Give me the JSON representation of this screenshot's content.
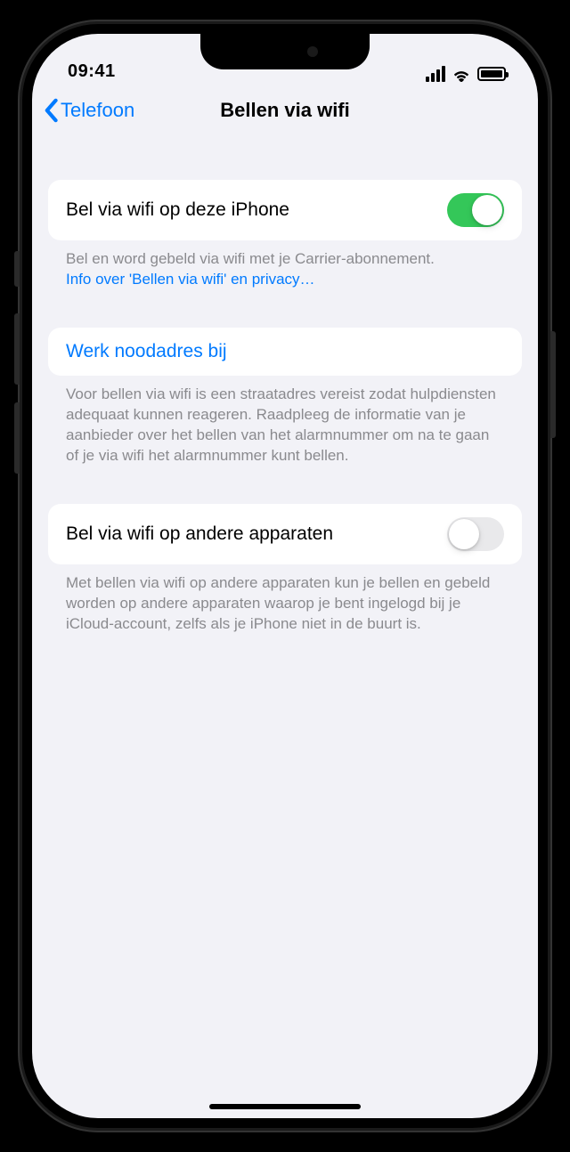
{
  "status": {
    "time": "09:41"
  },
  "nav": {
    "back_label": "Telefoon",
    "title": "Bellen via wifi"
  },
  "sections": {
    "wifi_this_iphone": {
      "label": "Bel via wifi op deze iPhone",
      "toggle_on": true,
      "footer_text": "Bel en word gebeld via wifi met je Carrier-abonnement.",
      "footer_link": "Info over 'Bellen via wifi' en privacy…"
    },
    "emergency": {
      "label": "Werk noodadres bij",
      "footer_text": "Voor bellen via wifi is een straatadres vereist zodat hulpdiensten adequaat kunnen reageren. Raadpleeg de informatie van je aanbieder over het bellen van het alarmnummer om na te gaan of je via wifi het alarmnummer kunt bellen."
    },
    "other_devices": {
      "label": "Bel via wifi op andere apparaten",
      "toggle_on": false,
      "footer_text": "Met bellen via wifi op andere apparaten kun je bellen en gebeld worden op andere apparaten waarop je bent ingelogd bij je iCloud-account, zelfs als je iPhone niet in de buurt is."
    }
  }
}
